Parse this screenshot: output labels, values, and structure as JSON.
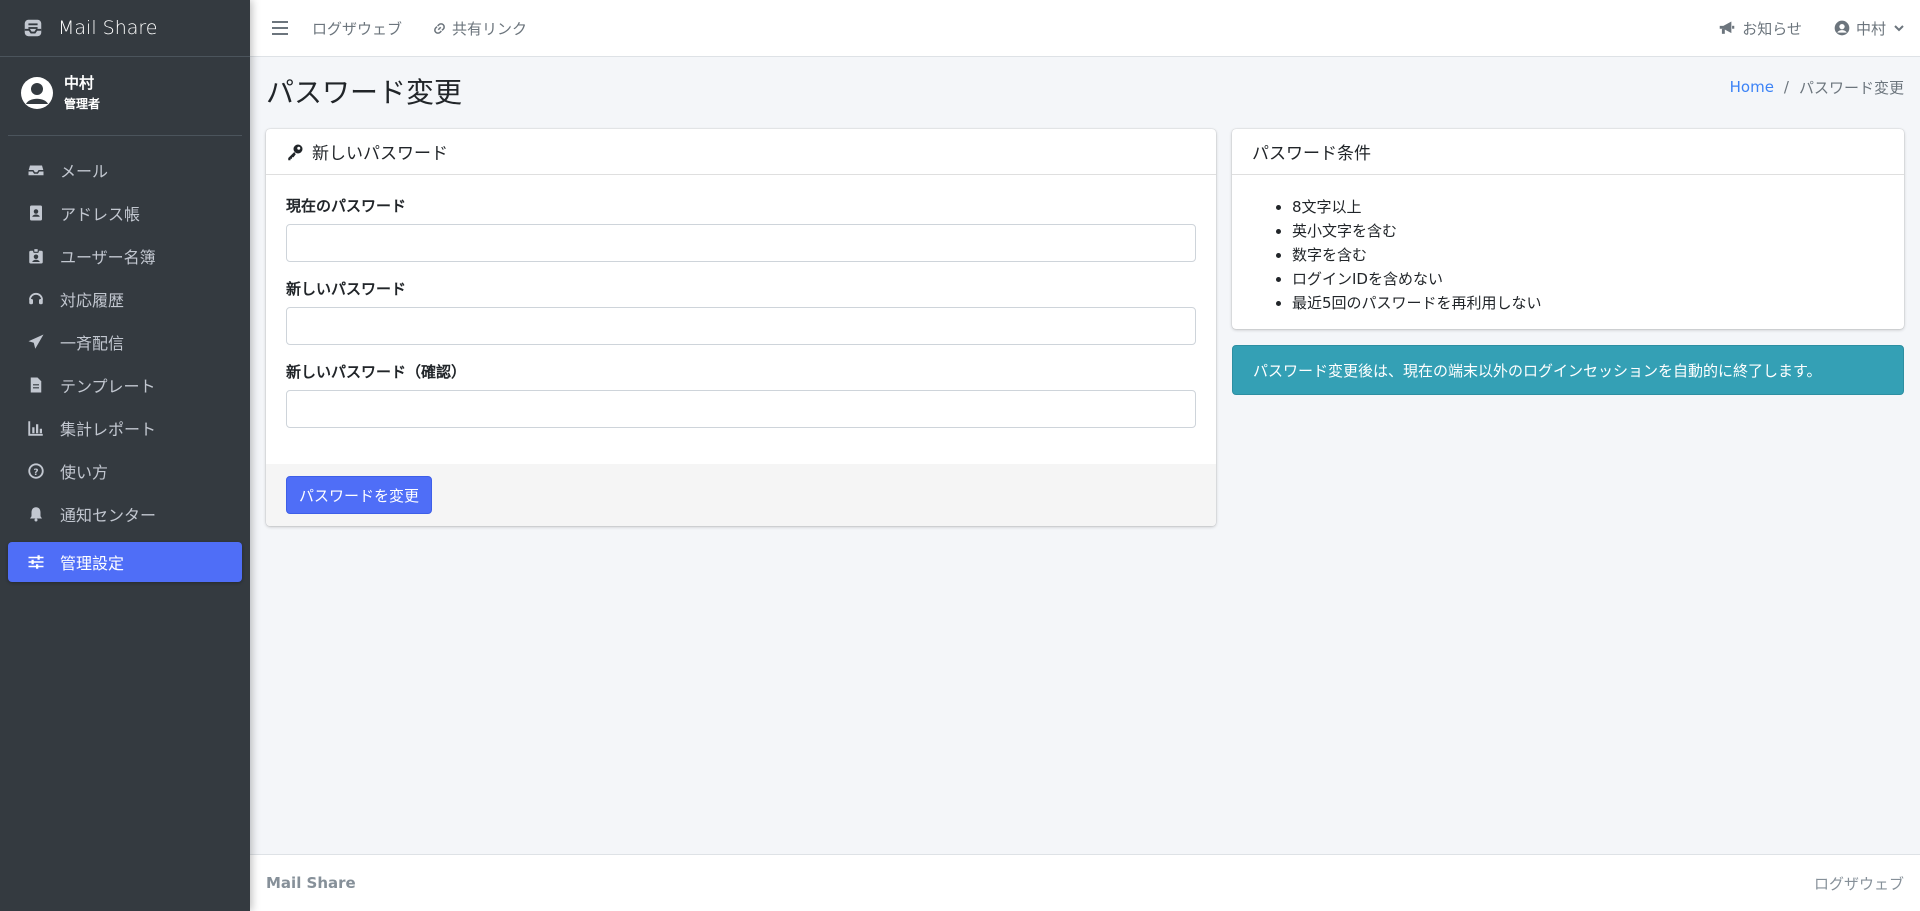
{
  "app": {
    "brand_name": "Mail Share",
    "brand_icon": "mail-share-icon"
  },
  "user_panel": {
    "name": "中村",
    "role": "管理者"
  },
  "sidebar": {
    "items": [
      {
        "label": "メール",
        "icon": "inbox-icon"
      },
      {
        "label": "アドレス帳",
        "icon": "address-book-icon"
      },
      {
        "label": "ユーザー名簿",
        "icon": "id-badge-icon"
      },
      {
        "label": "対応履歴",
        "icon": "headset-icon"
      },
      {
        "label": "一斉配信",
        "icon": "paper-plane-icon"
      },
      {
        "label": "テンプレート",
        "icon": "file-icon"
      },
      {
        "label": "集計レポート",
        "icon": "chart-bar-icon"
      },
      {
        "label": "使い方",
        "icon": "question-circle-icon"
      },
      {
        "label": "通知センター",
        "icon": "bell-icon"
      },
      {
        "label": "管理設定",
        "icon": "sliders-icon",
        "active": true
      }
    ]
  },
  "header": {
    "logout_label": "ログザウェブ",
    "share_link_label": "共有リンク",
    "notice_label": "お知らせ",
    "user_label": "中村"
  },
  "page": {
    "title": "パスワード変更",
    "breadcrumb": {
      "home": "Home",
      "separator": "/",
      "current": "パスワード変更"
    }
  },
  "form_card": {
    "header": "新しいパスワード",
    "fields": [
      {
        "label": "現在のパスワード",
        "value": ""
      },
      {
        "label": "新しいパスワード",
        "value": ""
      },
      {
        "label": "新しいパスワード（確認）",
        "value": ""
      }
    ],
    "submit_label": "パスワードを変更"
  },
  "rules_card": {
    "header": "パスワード条件",
    "rules": [
      "8文字以上",
      "英小文字を含む",
      "数字を含む",
      "ログインIDを含めない",
      "最近5回のパスワードを再利用しない"
    ]
  },
  "info_alert": {
    "text": "パスワード変更後は、現在の端末以外のログインセッションを自動的に終了します。"
  },
  "footer": {
    "left": "Mail Share",
    "right": "ログザウェブ"
  },
  "colors": {
    "sidebar_bg": "#343a40",
    "accent": "#4f6ef7",
    "info": "#34a0b5",
    "link": "#3b82f6"
  }
}
